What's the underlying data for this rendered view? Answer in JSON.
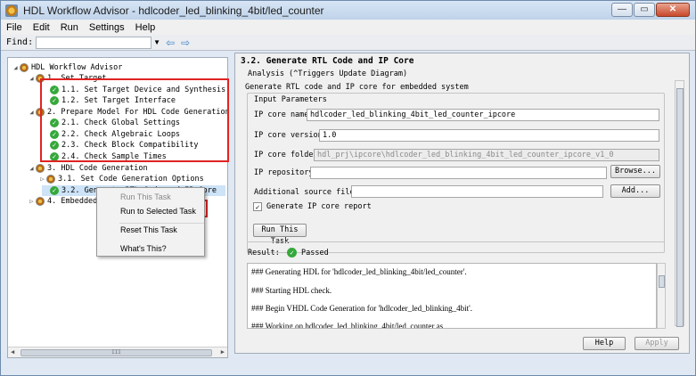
{
  "window": {
    "title": "HDL Workflow Advisor - hdlcoder_led_blinking_4bit/led_counter",
    "controls": [
      "—",
      "▭",
      "✕"
    ]
  },
  "menu": [
    "File",
    "Edit",
    "Run",
    "Settings",
    "Help"
  ],
  "find": {
    "label": "Find:",
    "value": "",
    "dropdown": "▼",
    "back": "⇦",
    "forward": "⇨"
  },
  "tree": {
    "items": [
      {
        "text": "HDL Workflow Advisor",
        "twisty": "◢",
        "icon": "folder-icon"
      },
      {
        "text": "1. Set Target",
        "twisty": "◢",
        "icon": "folder-icon"
      },
      {
        "text": "1.1. Set Target Device and Synthesis Tool",
        "twisty": "",
        "icon": "check-icon"
      },
      {
        "text": "1.2. Set Target Interface",
        "twisty": "",
        "icon": "check-icon"
      },
      {
        "text": "2. Prepare Model For HDL Code Generation",
        "twisty": "◢",
        "icon": "folder-icon"
      },
      {
        "text": "2.1. Check Global Settings",
        "twisty": "",
        "icon": "check-icon"
      },
      {
        "text": "2.2. Check Algebraic Loops",
        "twisty": "",
        "icon": "check-icon"
      },
      {
        "text": "2.3. Check Block Compatibility",
        "twisty": "",
        "icon": "check-icon"
      },
      {
        "text": "2.4. Check Sample Times",
        "twisty": "",
        "icon": "check-icon"
      },
      {
        "text": "3. HDL Code Generation",
        "twisty": "◢",
        "icon": "folder-icon"
      },
      {
        "text": "3.1. Set Code Generation Options",
        "twisty": "▷",
        "icon": "folder-icon"
      },
      {
        "text": "3.2. Generate RTL Code and IP Core",
        "twisty": "",
        "icon": "check-icon"
      },
      {
        "text": "4. Embedded System Integration",
        "twisty": "▷",
        "icon": "folder-icon"
      }
    ],
    "scroll_left": "◀",
    "scroll_right": "▶",
    "thumb_grip": "III"
  },
  "context_menu": [
    "Run This Task",
    "Run to Selected Task",
    "Reset This Task",
    "What's This?"
  ],
  "right": {
    "section_title": "3.2. Generate RTL Code and IP Core",
    "analysis": "Analysis (^Triggers Update Diagram)",
    "description": "Generate RTL code and IP core for embedded system",
    "group_title": "Input Parameters",
    "ip_core_name_label": "IP core name:",
    "ip_core_name": "hdlcoder_led_blinking_4bit_led_counter_ipcore",
    "ip_core_version_label": "IP core version:",
    "ip_core_version": "1.0",
    "ip_core_folder_label": "IP core folder:",
    "ip_core_folder": "hdl_prj\\ipcore\\hdlcoder_led_blinking_4bit_led_counter_ipcore_v1_0",
    "ip_repository_label": "IP repository:",
    "browse_button": "Browse...",
    "additional_source_label": "Additional source files:",
    "add_button": "Add...",
    "generate_report_label": "Generate IP core report",
    "generate_report_checked": "✓",
    "run_button": "Run This Task",
    "result_label": "Result:",
    "result_value": "Passed",
    "log": [
      "### Generating HDL for 'hdlcoder_led_blinking_4bit/led_counter'.",
      "### Starting HDL check.",
      "### Begin VHDL Code Generation for 'hdlcoder_led_blinking_4bit'.",
      "### Working on hdlcoder_led_blinking_4bit/led_counter as"
    ],
    "help_button": "Help",
    "apply_button": "Apply"
  },
  "colors": {
    "highlight_box": "#e02323",
    "passed": "#35a83a"
  }
}
